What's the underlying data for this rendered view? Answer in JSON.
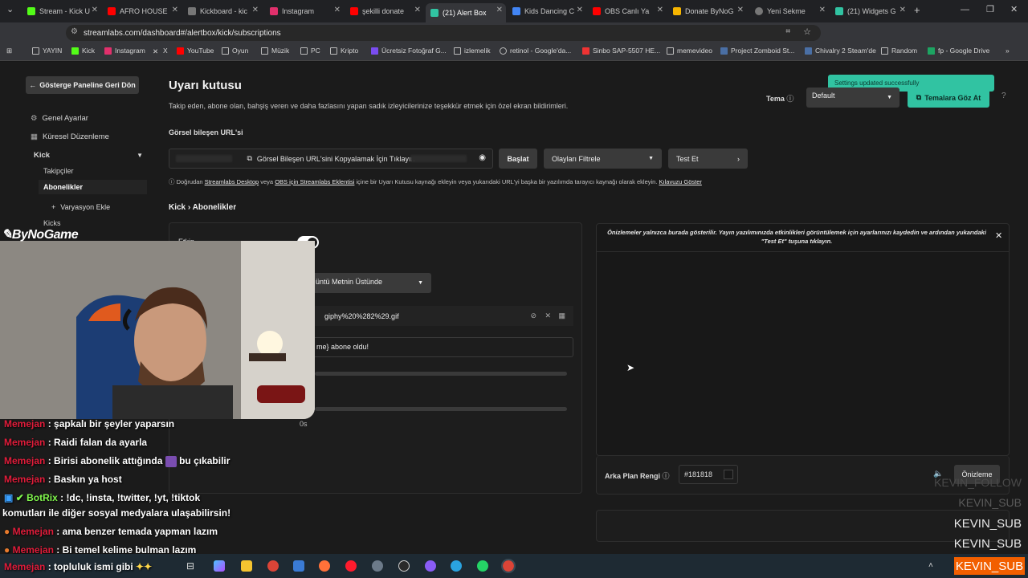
{
  "tabs": [
    {
      "label": "Stream - Kick U",
      "color": "#53fc18"
    },
    {
      "label": "AFRO HOUSE",
      "color": "#ff0000"
    },
    {
      "label": "Kickboard - kic",
      "color": "#888888"
    },
    {
      "label": "Instagram",
      "color": "#e1306c"
    },
    {
      "label": "şekilli donate",
      "color": "#ff0000"
    },
    {
      "label": "(21) Alert Box",
      "color": "#31c3a2"
    },
    {
      "label": "Kids Dancing C",
      "color": "#4285f4"
    },
    {
      "label": "OBS Canlı Ya",
      "color": "#ff0000"
    },
    {
      "label": "Donate ByNoG",
      "color": "#f7b500"
    },
    {
      "label": "Yeni Sekme",
      "color": "#888888"
    },
    {
      "label": "(21) Widgets G",
      "color": "#31c3a2"
    }
  ],
  "address": {
    "url": "streamlabs.com/dashboard#/alertbox/kick/subscriptions"
  },
  "bookmarks": [
    "YAYIN",
    "Kick",
    "Instagram",
    "X",
    "YouTube",
    "Oyun",
    "Müzik",
    "PC",
    "Kripto",
    "Ücretsiz Fotoğraf G...",
    "izlemelik",
    "retinol - Google'da...",
    "Sinbo SAP-5507 HE...",
    "memevideo",
    "Project Zomboid St...",
    "Chivalry 2 Steam'de",
    "Random",
    "fp - Google Drive"
  ],
  "sidebar": {
    "back_label": "Gösterge Paneline Geri Dön",
    "general": "Genel Ayarlar",
    "global": "Küresel Düzenleme",
    "group": "Kick",
    "followers": "Takipçiler",
    "subscribers": "Abonelikler",
    "add_variation": "Varyasyon Ekle",
    "kicks": "Kicks"
  },
  "main": {
    "title": "Uyarı kutusu",
    "subtitle": "Takip eden, abone olan, bahşiş veren ve daha fazlasını yapan sadık izleyicilerinize teşekkür etmek için özel ekran bildirimleri.",
    "widget_url_label": "Görsel bileşen URL'si",
    "copy_url_label": "Görsel Bileşen URL'sini Kopyalamak İçin Tıklayın",
    "launch": "Başlat",
    "filter_events": "Olayları Filtrele",
    "test": "Test Et",
    "note_prefix": "Doğrudan",
    "note_link1": "Streamlabs Desktop",
    "note_mid1": "veya",
    "note_link2": "OBS için Streamlabs Eklentisi",
    "note_mid2": "içine bir Uyarı Kutusu kaynağı ekleyin veya yukarıdaki URL'yi başka bir yazılımda tarayıcı kaynağı olarak ekleyin.",
    "note_link3": "Kılavuzu Göster",
    "breadcrumb": "Kick › Abonelikler",
    "enabled_label": "Etkin",
    "layout_value": "üntü Metnin Üstünde",
    "file_name": "giphy%20%282%29.gif",
    "message_text": "me} abone oldu!",
    "duration_label": "0s"
  },
  "toast": "Settings updated successfully",
  "theme": {
    "label": "Tema",
    "value": "Default",
    "browse": "Temalara Göz At"
  },
  "preview": {
    "message": "Önizlemeler yalnızca burada gösterilir. Yayın yazılımınızda etkinlikleri görüntülemek için ayarlarınızı kaydedin ve ardından yukarıdaki \"Test Et\" tuşuna tıklayın.",
    "bg_label": "Arka Plan Rengi",
    "bg_value": "#181818",
    "preview_button": "Önizleme"
  },
  "overlay": {
    "logo": "ByNoGame",
    "chat": [
      {
        "user": "Memejan",
        "text": ": şapkalı bir şeyler yaparsın"
      },
      {
        "user": "Memejan",
        "text": ": Raidi falan da ayarla"
      },
      {
        "user": "Memejan",
        "text": ": Birisi abonelik attığında",
        "suffix": "bu çıkabilir"
      },
      {
        "user": "Memejan",
        "text": ": Baskın ya host"
      },
      {
        "user": "BotRix",
        "text": ": !dc, !insta, !twitter, !yt, !tiktok",
        "bot": true
      },
      {
        "user": "",
        "text": "komutları ile diğer sosyal medyalara ulaşabilirsin!"
      },
      {
        "user": "Memejan",
        "text": ": ama benzer temada yapman lazım"
      },
      {
        "user": "Memejan",
        "text": ": Bi temel kelime bulman lazım"
      },
      {
        "user": "Memejan",
        "text": ": topluluk ismi gibi"
      }
    ],
    "kevin": [
      "KEVIN_FOLLOW",
      "KEVIN_SUB",
      "KEVIN_SUB",
      "KEVIN_SUB",
      "KEVIN_SUB"
    ]
  }
}
